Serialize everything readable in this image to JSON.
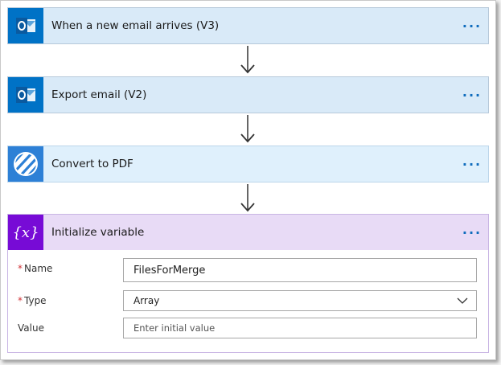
{
  "steps": [
    {
      "title": "When a new email arrives (V3)",
      "icon": "outlook-icon",
      "more": "···"
    },
    {
      "title": "Export email (V2)",
      "icon": "outlook-icon",
      "more": "···"
    },
    {
      "title": "Convert to PDF",
      "icon": "pdf-converter-icon",
      "more": "···"
    },
    {
      "title": "Initialize variable",
      "icon": "variable-icon",
      "more": "···"
    }
  ],
  "variable_form": {
    "required_mark": "*",
    "name_label": "Name",
    "name_value": "FilesForMerge",
    "type_label": "Type",
    "type_value": "Array",
    "value_label": "Value",
    "value_placeholder": "Enter initial value"
  },
  "colors": {
    "outlook_blue": "#0072c6",
    "variable_purple": "#770bd6",
    "more_dots": "#0f6cbd"
  }
}
